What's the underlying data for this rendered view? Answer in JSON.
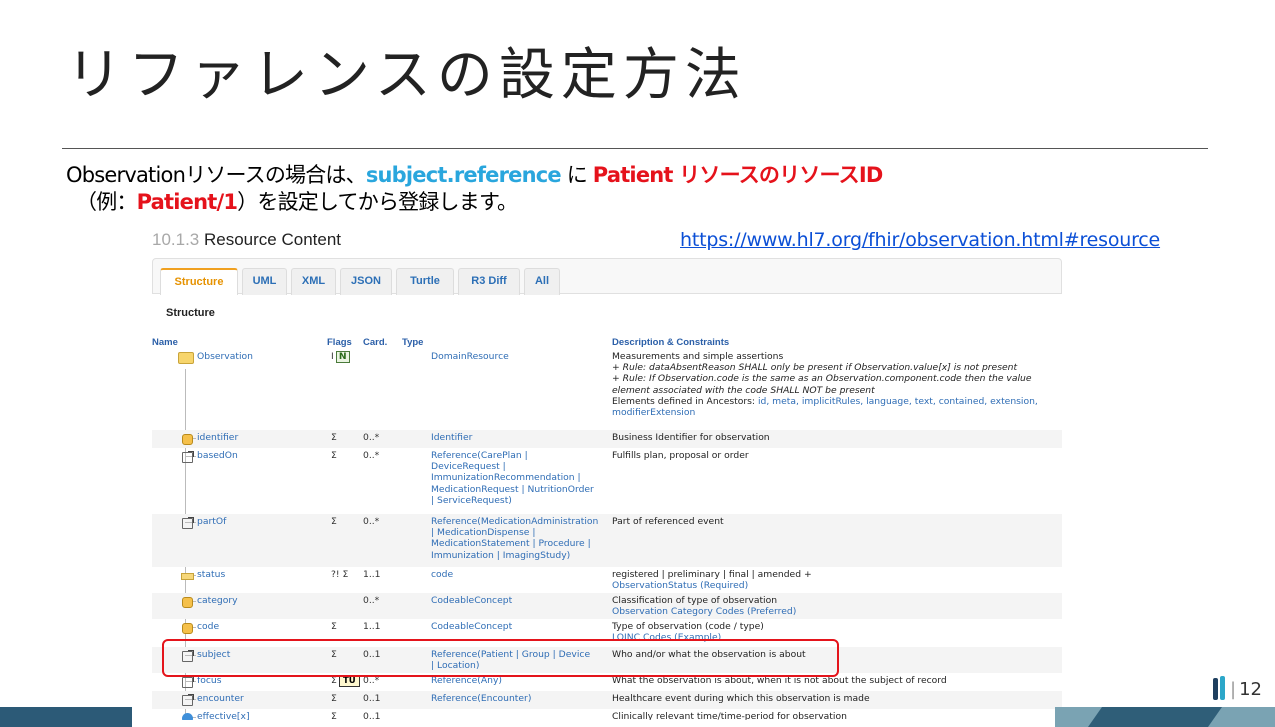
{
  "slide": {
    "title": "リファレンスの設定方法",
    "intro": {
      "p1": "Observationリソースの場合は、",
      "field": "subject.reference",
      "p2": " に ",
      "patient_id": "Patient リソースのリソースID",
      "line2_open": "（例：",
      "example": "Patient/1",
      "line2_close": "）を設定してから登録します。"
    },
    "section_num": "10.1.3",
    "section_title": " Resource Content",
    "url": "https://www.hl7.org/fhir/observation.html#resource",
    "page_number": "12"
  },
  "fhir": {
    "tabs": [
      "Structure",
      "UML",
      "XML",
      "JSON",
      "Turtle",
      "R3 Diff",
      "All"
    ],
    "active_tab": "Structure",
    "structure_label": "Structure",
    "headers": {
      "name": "Name",
      "flags": "Flags",
      "card": "Card.",
      "type": "Type",
      "desc": "Description & Constraints"
    },
    "rows": [
      {
        "name": "Observation",
        "flags": "I",
        "badge": "N",
        "card": "",
        "type": "DomainResource",
        "desc1": "Measurements and simple assertions",
        "desc2": "+ Rule: dataAbsentReason SHALL only be present if Observation.value[x] is not present",
        "desc3": "+ Rule: If Observation.code is the same as an Observation.component.code then the value",
        "desc4": "element associated with the code SHALL NOT be present",
        "desc5_prefix": "Elements defined in Ancestors: ",
        "desc5_links": "id, meta, implicitRules, language, text, contained, extension,",
        "desc6": "modifierExtension"
      },
      {
        "name": "identifier",
        "flags": "Σ",
        "card": "0..*",
        "type": "Identifier",
        "desc": "Business Identifier for observation"
      },
      {
        "name": "basedOn",
        "flags": "Σ",
        "card": "0..*",
        "type1": "Reference(CarePlan |",
        "type2": "DeviceRequest |",
        "type3": "ImmunizationRecommendation |",
        "type4": "MedicationRequest | NutritionOrder",
        "type5": "| ServiceRequest)",
        "desc": "Fulfills plan, proposal or order"
      },
      {
        "name": "partOf",
        "flags": "Σ",
        "card": "0..*",
        "type1": "Reference(MedicationAdministration",
        "type2": "| MedicationDispense |",
        "type3": "MedicationStatement | Procedure |",
        "type4": "Immunization | ImagingStudy)",
        "desc": "Part of referenced event"
      },
      {
        "name": "status",
        "flags": "?! Σ",
        "card": "1..1",
        "type": "code",
        "desc1": "registered | preliminary | final | amended +",
        "desc2": "ObservationStatus (Required)"
      },
      {
        "name": "category",
        "flags": "",
        "card": "0..*",
        "type": "CodeableConcept",
        "desc1": "Classification of type of observation",
        "desc2": "Observation Category Codes (Preferred)"
      },
      {
        "name": "code",
        "flags": "Σ",
        "card": "1..1",
        "type": "CodeableConcept",
        "desc1": "Type of observation (code / type)",
        "desc2": "LOINC Codes (Example)"
      },
      {
        "name": "subject",
        "flags": "Σ",
        "card": "0..1",
        "type1": "Reference(Patient | Group | Device",
        "type2": "| Location)",
        "desc": "Who and/or what the observation is about"
      },
      {
        "name": "focus",
        "flags": "Σ",
        "badge": "TU",
        "card": "0..*",
        "type": "Reference(Any)",
        "desc": "What the observation is about, when it is not about the subject of record"
      },
      {
        "name": "encounter",
        "flags": "Σ",
        "card": "0..1",
        "type": "Reference(Encounter)",
        "desc": "Healthcare event during which this observation is made"
      },
      {
        "name": "effective[x]",
        "flags": "Σ",
        "card": "0..1",
        "type": "",
        "desc": "Clinically relevant time/time-period for observation"
      }
    ]
  }
}
